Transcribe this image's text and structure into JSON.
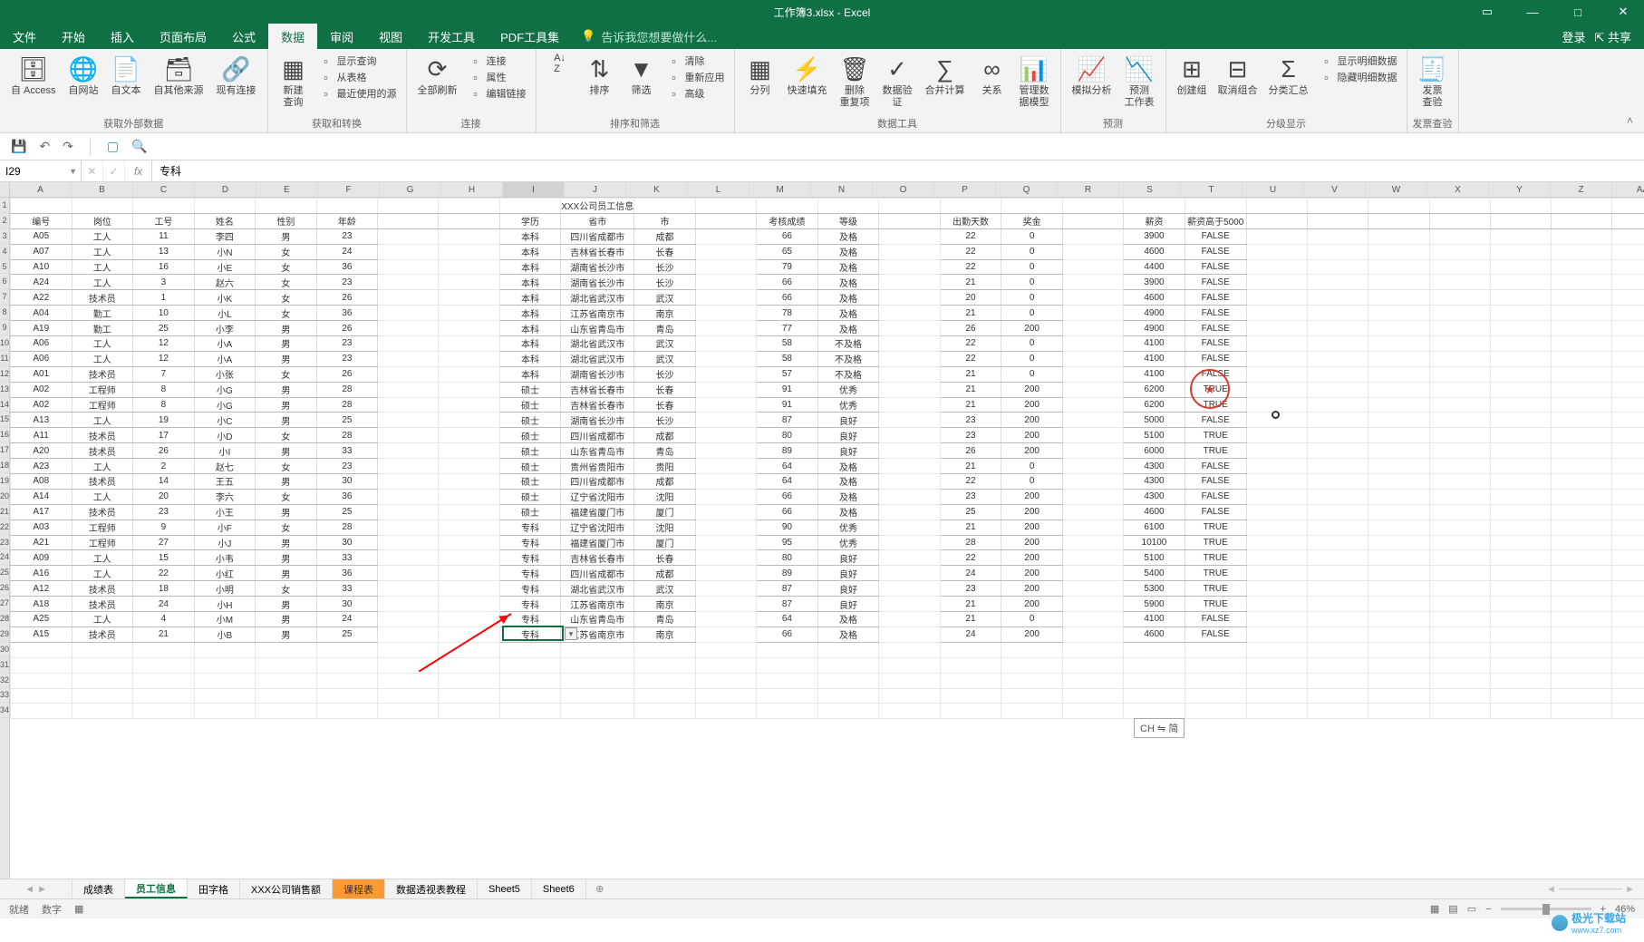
{
  "title": "工作簿3.xlsx - Excel",
  "login": "登录",
  "share": "共享",
  "menu": [
    "文件",
    "开始",
    "插入",
    "页面布局",
    "公式",
    "数据",
    "审阅",
    "视图",
    "开发工具",
    "PDF工具集"
  ],
  "menu_active": 5,
  "tellme_placeholder": "告诉我您想要做什么...",
  "ribbon": {
    "g1": {
      "items": [
        "自 Access",
        "自网站",
        "自文本",
        "自其他来源",
        "现有连接"
      ],
      "label": "获取外部数据"
    },
    "g2": {
      "big": "新建\n查询",
      "small": [
        "显示查询",
        "从表格",
        "最近使用的源"
      ],
      "label": "获取和转换"
    },
    "g3": {
      "big": "全部刷新",
      "small": [
        "连接",
        "属性",
        "编辑链接"
      ],
      "label": "连接"
    },
    "g4": {
      "items": [
        "",
        "排序",
        "筛选"
      ],
      "small": [
        "清除",
        "重新应用",
        "高级"
      ],
      "label": "排序和筛选"
    },
    "g5": {
      "items": [
        "分列",
        "快速填充",
        "删除\n重复项",
        "数据验\n证",
        "合并计算",
        "关系",
        "管理数\n据模型"
      ],
      "label": "数据工具"
    },
    "g6": {
      "items": [
        "模拟分析",
        "预测\n工作表"
      ],
      "label": "预测"
    },
    "g7": {
      "items": [
        "创建组",
        "取消组合",
        "分类汇总"
      ],
      "small": [
        "显示明细数据",
        "隐藏明细数据"
      ],
      "label": "分级显示"
    },
    "g8": {
      "items": [
        "发票\n查验"
      ],
      "label": "发票查验"
    }
  },
  "namebox": "I29",
  "formula": "专科",
  "columns": [
    "A",
    "B",
    "C",
    "D",
    "E",
    "F",
    "G",
    "H",
    "I",
    "J",
    "K",
    "L",
    "M",
    "N",
    "O",
    "P",
    "Q",
    "R",
    "S",
    "T",
    "U",
    "V",
    "W",
    "X",
    "Y",
    "Z",
    "AA"
  ],
  "row_count": 34,
  "title_row": "XXX公司员工信息",
  "headers": [
    "编号",
    "岗位",
    "工号",
    "姓名",
    "性别",
    "年龄",
    "",
    "",
    "学历",
    "省市",
    "市",
    "",
    "考核成绩",
    "等级",
    "",
    "出勤天数",
    "奖金",
    "",
    "薪资",
    "薪资高于5000"
  ],
  "data": [
    [
      "A05",
      "工人",
      "11",
      "李四",
      "男",
      "23",
      "",
      "",
      "本科",
      "四川省成都市",
      "成都",
      "",
      "66",
      "及格",
      "",
      "22",
      "0",
      "",
      "3900",
      "FALSE"
    ],
    [
      "A07",
      "工人",
      "13",
      "小N",
      "女",
      "24",
      "",
      "",
      "本科",
      "吉林省长春市",
      "长春",
      "",
      "65",
      "及格",
      "",
      "22",
      "0",
      "",
      "4600",
      "FALSE"
    ],
    [
      "A10",
      "工人",
      "16",
      "小E",
      "女",
      "36",
      "",
      "",
      "本科",
      "湖南省长沙市",
      "长沙",
      "",
      "79",
      "及格",
      "",
      "22",
      "0",
      "",
      "4400",
      "FALSE"
    ],
    [
      "A24",
      "工人",
      "3",
      "赵六",
      "女",
      "23",
      "",
      "",
      "本科",
      "湖南省长沙市",
      "长沙",
      "",
      "66",
      "及格",
      "",
      "21",
      "0",
      "",
      "3900",
      "FALSE"
    ],
    [
      "A22",
      "技术员",
      "1",
      "小K",
      "女",
      "26",
      "",
      "",
      "本科",
      "湖北省武汉市",
      "武汉",
      "",
      "66",
      "及格",
      "",
      "20",
      "0",
      "",
      "4600",
      "FALSE"
    ],
    [
      "A04",
      "勤工",
      "10",
      "小L",
      "女",
      "36",
      "",
      "",
      "本科",
      "江苏省南京市",
      "南京",
      "",
      "78",
      "及格",
      "",
      "21",
      "0",
      "",
      "4900",
      "FALSE"
    ],
    [
      "A19",
      "勤工",
      "25",
      "小李",
      "男",
      "26",
      "",
      "",
      "本科",
      "山东省青岛市",
      "青岛",
      "",
      "77",
      "及格",
      "",
      "26",
      "200",
      "",
      "4900",
      "FALSE"
    ],
    [
      "A06",
      "工人",
      "12",
      "小A",
      "男",
      "23",
      "",
      "",
      "本科",
      "湖北省武汉市",
      "武汉",
      "",
      "58",
      "不及格",
      "",
      "22",
      "0",
      "",
      "4100",
      "FALSE"
    ],
    [
      "A06",
      "工人",
      "12",
      "小A",
      "男",
      "23",
      "",
      "",
      "本科",
      "湖北省武汉市",
      "武汉",
      "",
      "58",
      "不及格",
      "",
      "22",
      "0",
      "",
      "4100",
      "FALSE"
    ],
    [
      "A01",
      "技术员",
      "7",
      "小张",
      "女",
      "26",
      "",
      "",
      "本科",
      "湖南省长沙市",
      "长沙",
      "",
      "57",
      "不及格",
      "",
      "21",
      "0",
      "",
      "4100",
      "FALSE"
    ],
    [
      "A02",
      "工程师",
      "8",
      "小G",
      "男",
      "28",
      "",
      "",
      "硕士",
      "吉林省长春市",
      "长春",
      "",
      "91",
      "优秀",
      "",
      "21",
      "200",
      "",
      "6200",
      "TRUE"
    ],
    [
      "A02",
      "工程师",
      "8",
      "小G",
      "男",
      "28",
      "",
      "",
      "硕士",
      "吉林省长春市",
      "长春",
      "",
      "91",
      "优秀",
      "",
      "21",
      "200",
      "",
      "6200",
      "TRUE"
    ],
    [
      "A13",
      "工人",
      "19",
      "小C",
      "男",
      "25",
      "",
      "",
      "硕士",
      "湖南省长沙市",
      "长沙",
      "",
      "87",
      "良好",
      "",
      "23",
      "200",
      "",
      "5000",
      "FALSE"
    ],
    [
      "A11",
      "技术员",
      "17",
      "小D",
      "女",
      "28",
      "",
      "",
      "硕士",
      "四川省成都市",
      "成都",
      "",
      "80",
      "良好",
      "",
      "23",
      "200",
      "",
      "5100",
      "TRUE"
    ],
    [
      "A20",
      "技术员",
      "26",
      "小I",
      "男",
      "33",
      "",
      "",
      "硕士",
      "山东省青岛市",
      "青岛",
      "",
      "89",
      "良好",
      "",
      "26",
      "200",
      "",
      "6000",
      "TRUE"
    ],
    [
      "A23",
      "工人",
      "2",
      "赵七",
      "女",
      "23",
      "",
      "",
      "硕士",
      "贵州省贵阳市",
      "贵阳",
      "",
      "64",
      "及格",
      "",
      "21",
      "0",
      "",
      "4300",
      "FALSE"
    ],
    [
      "A08",
      "技术员",
      "14",
      "王五",
      "男",
      "30",
      "",
      "",
      "硕士",
      "四川省成都市",
      "成都",
      "",
      "64",
      "及格",
      "",
      "22",
      "0",
      "",
      "4300",
      "FALSE"
    ],
    [
      "A14",
      "工人",
      "20",
      "李六",
      "女",
      "36",
      "",
      "",
      "硕士",
      "辽宁省沈阳市",
      "沈阳",
      "",
      "66",
      "及格",
      "",
      "23",
      "200",
      "",
      "4300",
      "FALSE"
    ],
    [
      "A17",
      "技术员",
      "23",
      "小王",
      "男",
      "25",
      "",
      "",
      "硕士",
      "福建省厦门市",
      "厦门",
      "",
      "66",
      "及格",
      "",
      "25",
      "200",
      "",
      "4600",
      "FALSE"
    ],
    [
      "A03",
      "工程师",
      "9",
      "小F",
      "女",
      "28",
      "",
      "",
      "专科",
      "辽宁省沈阳市",
      "沈阳",
      "",
      "90",
      "优秀",
      "",
      "21",
      "200",
      "",
      "6100",
      "TRUE"
    ],
    [
      "A21",
      "工程师",
      "27",
      "小J",
      "男",
      "30",
      "",
      "",
      "专科",
      "福建省厦门市",
      "厦门",
      "",
      "95",
      "优秀",
      "",
      "28",
      "200",
      "",
      "10100",
      "TRUE"
    ],
    [
      "A09",
      "工人",
      "15",
      "小韦",
      "男",
      "33",
      "",
      "",
      "专科",
      "吉林省长春市",
      "长春",
      "",
      "80",
      "良好",
      "",
      "22",
      "200",
      "",
      "5100",
      "TRUE"
    ],
    [
      "A16",
      "工人",
      "22",
      "小红",
      "男",
      "36",
      "",
      "",
      "专科",
      "四川省成都市",
      "成都",
      "",
      "89",
      "良好",
      "",
      "24",
      "200",
      "",
      "5400",
      "TRUE"
    ],
    [
      "A12",
      "技术员",
      "18",
      "小明",
      "女",
      "33",
      "",
      "",
      "专科",
      "湖北省武汉市",
      "武汉",
      "",
      "87",
      "良好",
      "",
      "23",
      "200",
      "",
      "5300",
      "TRUE"
    ],
    [
      "A18",
      "技术员",
      "24",
      "小H",
      "男",
      "30",
      "",
      "",
      "专科",
      "江苏省南京市",
      "南京",
      "",
      "87",
      "良好",
      "",
      "21",
      "200",
      "",
      "5900",
      "TRUE"
    ],
    [
      "A25",
      "工人",
      "4",
      "小M",
      "男",
      "24",
      "",
      "",
      "专科",
      "山东省青岛市",
      "青岛",
      "",
      "64",
      "及格",
      "",
      "21",
      "0",
      "",
      "4100",
      "FALSE"
    ],
    [
      "A15",
      "技术员",
      "21",
      "小B",
      "男",
      "25",
      "",
      "",
      "专科",
      "江苏省南京市",
      "南京",
      "",
      "66",
      "及格",
      "",
      "24",
      "200",
      "",
      "4600",
      "FALSE"
    ]
  ],
  "active_cell": {
    "row": 29,
    "col": 9
  },
  "sheets": [
    "成绩表",
    "员工信息",
    "田字格",
    "XXX公司销售额",
    "课程表",
    "数据透视表教程",
    "Sheet5",
    "Sheet6"
  ],
  "sheets_active": 1,
  "sheets_orange": 4,
  "status": {
    "ready": "就绪",
    "mode": "数字"
  },
  "ime": "CH ⇋ 简",
  "zoom": "46%",
  "watermark": {
    "site": "极光下载站",
    "url": "www.xz7.com"
  }
}
